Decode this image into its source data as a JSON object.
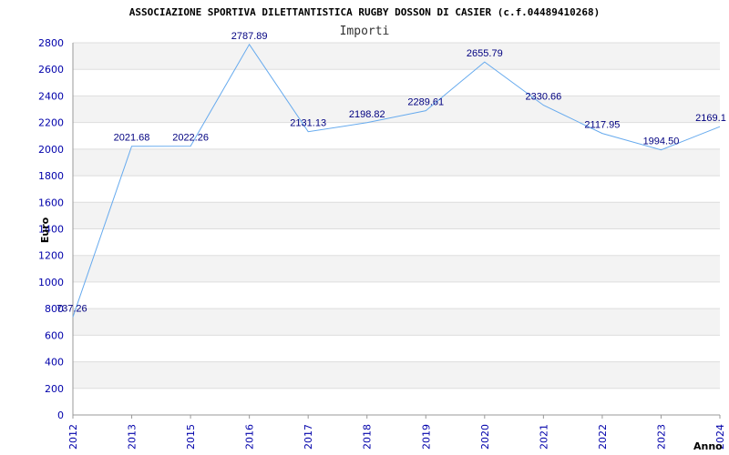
{
  "chart_data": {
    "type": "line",
    "title": "ASSOCIAZIONE SPORTIVA DILETTANTISTICA RUGBY DOSSON DI CASIER (c.f.04489410268)",
    "subtitle": "Importi",
    "xlabel": "Anno",
    "ylabel": "Euro",
    "ylim": [
      0,
      2800
    ],
    "yticks": [
      0,
      200,
      400,
      600,
      800,
      1000,
      1200,
      1400,
      1600,
      1800,
      2000,
      2200,
      2400,
      2600,
      2800
    ],
    "x": [
      "2012",
      "2013",
      "2015",
      "2016",
      "2017",
      "2018",
      "2019",
      "2020",
      "2021",
      "2022",
      "2023",
      "2024"
    ],
    "values": [
      737.26,
      2021.68,
      2022.26,
      2787.89,
      2131.13,
      2198.82,
      2289.61,
      2655.79,
      2330.66,
      2117.95,
      1994.5,
      2169.1
    ],
    "value_labels": [
      "737.26",
      "2021.68",
      "2022.26",
      "2787.89",
      "2131.13",
      "2198.82",
      "2289.61",
      "2655.79",
      "2330.66",
      "2117.95",
      "1994.50",
      "2169.1"
    ],
    "grid": true,
    "colors": {
      "line": "#66aaee",
      "band": "#f3f3f3",
      "grid": "#dddddd",
      "axis": "#999999",
      "tick_text": "#0000aa",
      "data_label": "#000080"
    }
  }
}
